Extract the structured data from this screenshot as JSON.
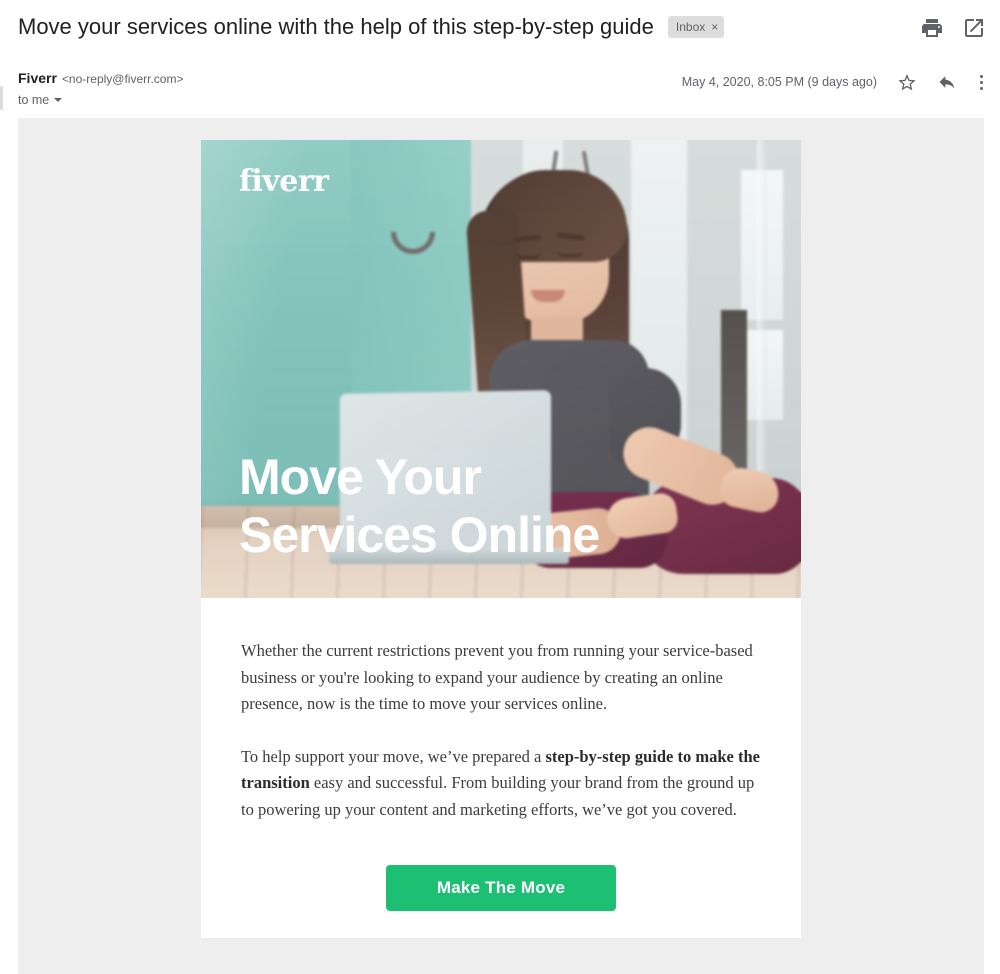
{
  "message": {
    "subject": "Move your services online with the help of this step-by-step guide",
    "label": {
      "name": "Inbox",
      "close": "×"
    },
    "sender_name": "Fiverr",
    "sender_email": "<no-reply@fiverr.com>",
    "recipient": "to me",
    "date": "May 4, 2020, 8:05 PM (9 days ago)",
    "header_actions": [
      {
        "name": "print-icon",
        "title": "Print all"
      },
      {
        "name": "open-in-new-window-icon",
        "title": "In new window"
      }
    ],
    "message_actions": [
      {
        "name": "star-icon",
        "title": "Not starred"
      },
      {
        "name": "reply-icon",
        "title": "Reply"
      },
      {
        "name": "more-options-icon",
        "title": "More"
      }
    ]
  },
  "email": {
    "logo": "fiverr",
    "hero_headline_line1": "Move Your",
    "hero_headline_line2": "Services Online",
    "paragraph1": "Whether the current restrictions prevent you from running your service-based business or you're looking to expand your audience by creating an online presence, now is the time to move your services online.",
    "paragraph2_part1": "To help support your move, we’ve prepared a ",
    "paragraph2_bold": "step-by-step guide to make the transition",
    "paragraph2_part2": " easy and successful. From building your brand from the ground up to powering up your content and marketing efforts, we’ve got you covered.",
    "cta_label": "Make The Move"
  },
  "colors": {
    "brand_green": "#1dbf73",
    "hero_teal": "#8ccac2",
    "backdrop_gray": "#eeeeee",
    "text_primary": "#202124",
    "text_secondary": "#5f6368"
  }
}
